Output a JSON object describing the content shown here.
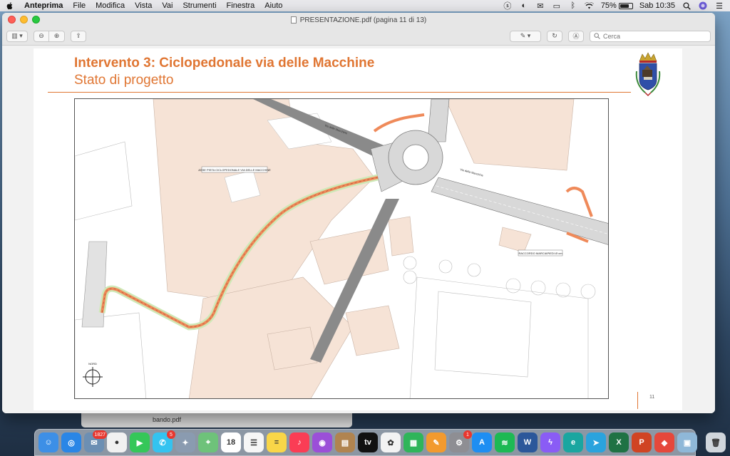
{
  "menubar": {
    "app_name": "Anteprima",
    "items": [
      "File",
      "Modifica",
      "Vista",
      "Vai",
      "Strumenti",
      "Finestra",
      "Aiuto"
    ],
    "battery_percent_label": "75%",
    "battery_level": 0.75,
    "clock": "Sab 10:35"
  },
  "window": {
    "title": "PRESENTAZIONE.pdf (pagina 11 di 13)",
    "search_placeholder": "Cerca"
  },
  "slide": {
    "title": "Intervento 3: Ciclopedonale via delle Macchine",
    "subtitle": "Stato di progetto",
    "page_number": "11",
    "map_label_axis": "ASSE PISTA CICLOPEDONALE VIA DELLE MACCHINE",
    "map_label_raccordo": "RACCORDO MARCIAPIEDI Ø cm",
    "map_label_street_1": "Via delle Macchine",
    "map_label_street_2": "Via della Macchine",
    "map_label_north": "NORD"
  },
  "behind_window": {
    "file_label": "bando.pdf"
  },
  "dock": {
    "apps": [
      {
        "name": "Finder",
        "color": "#3d8fe6",
        "glyph": "☺"
      },
      {
        "name": "Safari",
        "color": "#2a86e6",
        "glyph": "◎"
      },
      {
        "name": "Mail-Pic",
        "color": "#6c8fb3",
        "glyph": "✉",
        "badge": "1827"
      },
      {
        "name": "Chrome",
        "color": "#f1f1f1",
        "glyph": "●"
      },
      {
        "name": "FaceTime",
        "color": "#35c759",
        "glyph": "▶"
      },
      {
        "name": "Messages",
        "color": "#34c3f0",
        "glyph": "✆",
        "badge": "5"
      },
      {
        "name": "Launchpad",
        "color": "#8a9bb0",
        "glyph": "✦"
      },
      {
        "name": "Maps",
        "color": "#6ec27a",
        "glyph": "⌖"
      },
      {
        "name": "Calendar",
        "color": "#ffffff",
        "glyph": "18"
      },
      {
        "name": "Reminders",
        "color": "#f6f6f6",
        "glyph": "☰"
      },
      {
        "name": "Notes",
        "color": "#f9d648",
        "glyph": "≡"
      },
      {
        "name": "Music",
        "color": "#fa3d55",
        "glyph": "♪"
      },
      {
        "name": "Podcasts",
        "color": "#9b4fd8",
        "glyph": "◉"
      },
      {
        "name": "Notebook",
        "color": "#b08450",
        "glyph": "▤"
      },
      {
        "name": "TV",
        "color": "#111111",
        "glyph": "tv"
      },
      {
        "name": "Photos",
        "color": "#f3f3f3",
        "glyph": "✿"
      },
      {
        "name": "Numbers",
        "color": "#2fb55a",
        "glyph": "▦"
      },
      {
        "name": "Pages",
        "color": "#f29a2e",
        "glyph": "✎"
      },
      {
        "name": "System Preferences",
        "color": "#8e8e93",
        "glyph": "⚙",
        "badge": "1"
      },
      {
        "name": "App Store",
        "color": "#1e8ef2",
        "glyph": "A"
      },
      {
        "name": "Spotify",
        "color": "#1db954",
        "glyph": "≋"
      },
      {
        "name": "Word",
        "color": "#2b579a",
        "glyph": "W"
      },
      {
        "name": "Messenger",
        "color": "#8a5cf5",
        "glyph": "ϟ"
      },
      {
        "name": "Edge",
        "color": "#1aa6a0",
        "glyph": "e"
      },
      {
        "name": "Telegram",
        "color": "#2aa3dd",
        "glyph": "➤"
      },
      {
        "name": "Excel",
        "color": "#1f7244",
        "glyph": "X"
      },
      {
        "name": "PowerPoint",
        "color": "#d04423",
        "glyph": "P"
      },
      {
        "name": "AnyDesk",
        "color": "#e5483b",
        "glyph": "◆"
      },
      {
        "name": "Preview",
        "color": "#8fb8d8",
        "glyph": "▣"
      }
    ],
    "trash": {
      "name": "Trash",
      "color": "#d0d6dc",
      "glyph": "🗑"
    }
  }
}
